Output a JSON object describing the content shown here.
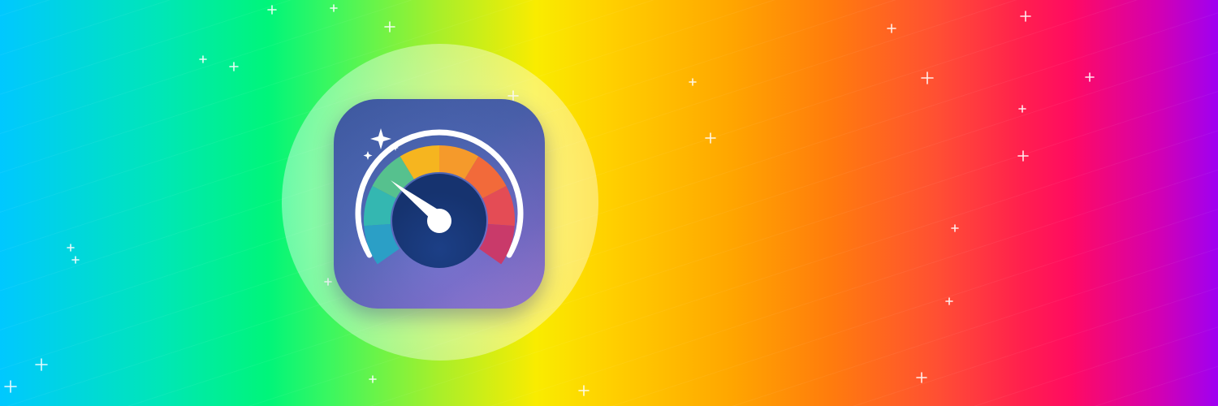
{
  "banner": {
    "gradient_colors": [
      "#00c8ff",
      "#00f57a",
      "#a8ef2a",
      "#f9ec00",
      "#ffa600",
      "#ff4f33",
      "#ff0b62",
      "#9f00f2"
    ]
  },
  "app_icon": {
    "icon": "speedometer-gauge-icon",
    "background_colors": [
      "#4a6bb8",
      "#a881dc"
    ],
    "gauge_segment_colors": [
      "#2b9fc6",
      "#34b7b1",
      "#56c18e",
      "#f6b51f",
      "#f59a2b",
      "#f26a3a",
      "#e44c55",
      "#c93a6a"
    ],
    "needle_color": "#ffffff",
    "sparkle_icon": "sparkle-icon"
  },
  "decorations": {
    "icon": "plus-sparkle-icon"
  }
}
